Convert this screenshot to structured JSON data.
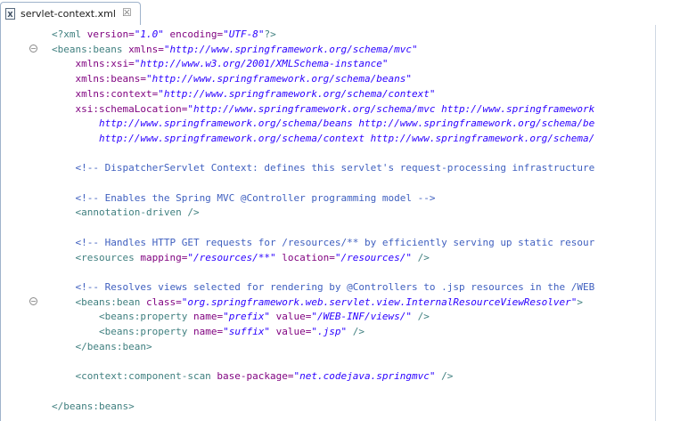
{
  "tab": {
    "title": "servlet-context.xml",
    "close_glyph": "☒",
    "icon_letter": "X"
  },
  "lines": [
    {
      "fold": false,
      "segments": [
        {
          "c": "t-pi",
          "t": "<?xml"
        },
        {
          "c": "t-attr",
          "t": " version="
        },
        {
          "c": "t-val",
          "t": "\"1.0\""
        },
        {
          "c": "t-attr",
          "t": " encoding="
        },
        {
          "c": "t-val",
          "t": "\"UTF-8\""
        },
        {
          "c": "t-pi",
          "t": "?>"
        }
      ]
    },
    {
      "fold": true,
      "segments": [
        {
          "c": "t-tag",
          "t": "<beans:beans"
        },
        {
          "c": "t-attr",
          "t": " xmlns="
        },
        {
          "c": "t-val",
          "t": "\"http://www.springframework.org/schema/mvc\""
        }
      ]
    },
    {
      "fold": false,
      "segments": [
        {
          "c": "t-attr",
          "t": "    xmlns:xsi="
        },
        {
          "c": "t-val",
          "t": "\"http://www.w3.org/2001/XMLSchema-instance\""
        }
      ]
    },
    {
      "fold": false,
      "segments": [
        {
          "c": "t-attr",
          "t": "    xmlns:beans="
        },
        {
          "c": "t-val",
          "t": "\"http://www.springframework.org/schema/beans\""
        }
      ]
    },
    {
      "fold": false,
      "segments": [
        {
          "c": "t-attr",
          "t": "    xmlns:context="
        },
        {
          "c": "t-val",
          "t": "\"http://www.springframework.org/schema/context\""
        }
      ]
    },
    {
      "fold": false,
      "segments": [
        {
          "c": "t-attr",
          "t": "    xsi:schemaLocation="
        },
        {
          "c": "t-val",
          "t": "\"http://www.springframework.org/schema/mvc http://www.springframework"
        }
      ]
    },
    {
      "fold": false,
      "segments": [
        {
          "c": "t-val",
          "t": "        http://www.springframework.org/schema/beans http://www.springframework.org/schema/be"
        }
      ]
    },
    {
      "fold": false,
      "segments": [
        {
          "c": "t-val",
          "t": "        http://www.springframework.org/schema/context http://www.springframework.org/schema/"
        }
      ]
    },
    {
      "fold": false,
      "segments": []
    },
    {
      "fold": false,
      "segments": [
        {
          "c": "t-com",
          "t": "    <!-- DispatcherServlet Context: defines this servlet's request-processing infrastructure"
        }
      ]
    },
    {
      "fold": false,
      "segments": []
    },
    {
      "fold": false,
      "segments": [
        {
          "c": "t-com",
          "t": "    <!-- Enables the Spring MVC @Controller programming model -->"
        }
      ]
    },
    {
      "fold": false,
      "segments": [
        {
          "c": "t-tag",
          "t": "    <annotation-driven />"
        }
      ]
    },
    {
      "fold": false,
      "segments": []
    },
    {
      "fold": false,
      "segments": [
        {
          "c": "t-com",
          "t": "    <!-- Handles HTTP GET requests for /resources/** by efficiently serving up static resour"
        }
      ]
    },
    {
      "fold": false,
      "segments": [
        {
          "c": "t-tag",
          "t": "    <resources"
        },
        {
          "c": "t-attr",
          "t": " mapping="
        },
        {
          "c": "t-val",
          "t": "\"/resources/**\""
        },
        {
          "c": "t-attr",
          "t": " location="
        },
        {
          "c": "t-val",
          "t": "\"/resources/\""
        },
        {
          "c": "t-tag",
          "t": " />"
        }
      ]
    },
    {
      "fold": false,
      "segments": []
    },
    {
      "fold": false,
      "segments": [
        {
          "c": "t-com",
          "t": "    <!-- Resolves views selected for rendering by @Controllers to .jsp resources in the /WEB"
        }
      ]
    },
    {
      "fold": true,
      "segments": [
        {
          "c": "t-tag",
          "t": "    <beans:bean"
        },
        {
          "c": "t-attr",
          "t": " class="
        },
        {
          "c": "t-val",
          "t": "\"org.springframework.web.servlet.view.InternalResourceViewResolver\""
        },
        {
          "c": "t-tag",
          "t": ">"
        }
      ]
    },
    {
      "fold": false,
      "segments": [
        {
          "c": "t-tag",
          "t": "        <beans:property"
        },
        {
          "c": "t-attr",
          "t": " name="
        },
        {
          "c": "t-val",
          "t": "\"prefix\""
        },
        {
          "c": "t-attr",
          "t": " value="
        },
        {
          "c": "t-val",
          "t": "\"/WEB-INF/views/\""
        },
        {
          "c": "t-tag",
          "t": " />"
        }
      ]
    },
    {
      "fold": false,
      "segments": [
        {
          "c": "t-tag",
          "t": "        <beans:property"
        },
        {
          "c": "t-attr",
          "t": " name="
        },
        {
          "c": "t-val",
          "t": "\"suffix\""
        },
        {
          "c": "t-attr",
          "t": " value="
        },
        {
          "c": "t-val",
          "t": "\".jsp\""
        },
        {
          "c": "t-tag",
          "t": " />"
        }
      ]
    },
    {
      "fold": false,
      "segments": [
        {
          "c": "t-tag",
          "t": "    </beans:bean>"
        }
      ]
    },
    {
      "fold": false,
      "segments": []
    },
    {
      "fold": false,
      "segments": [
        {
          "c": "t-tag",
          "t": "    <context:component-scan"
        },
        {
          "c": "t-attr",
          "t": " base-package="
        },
        {
          "c": "t-val",
          "t": "\"net.codejava.springmvc\""
        },
        {
          "c": "t-tag",
          "t": " />"
        }
      ]
    },
    {
      "fold": false,
      "segments": []
    },
    {
      "fold": false,
      "segments": [
        {
          "c": "t-tag",
          "t": "</beans:beans>"
        }
      ]
    }
  ],
  "colors": {
    "tag": "#3f7f7f",
    "attribute": "#7f007f",
    "value": "#2a00ff",
    "comment": "#3f5fbf"
  }
}
